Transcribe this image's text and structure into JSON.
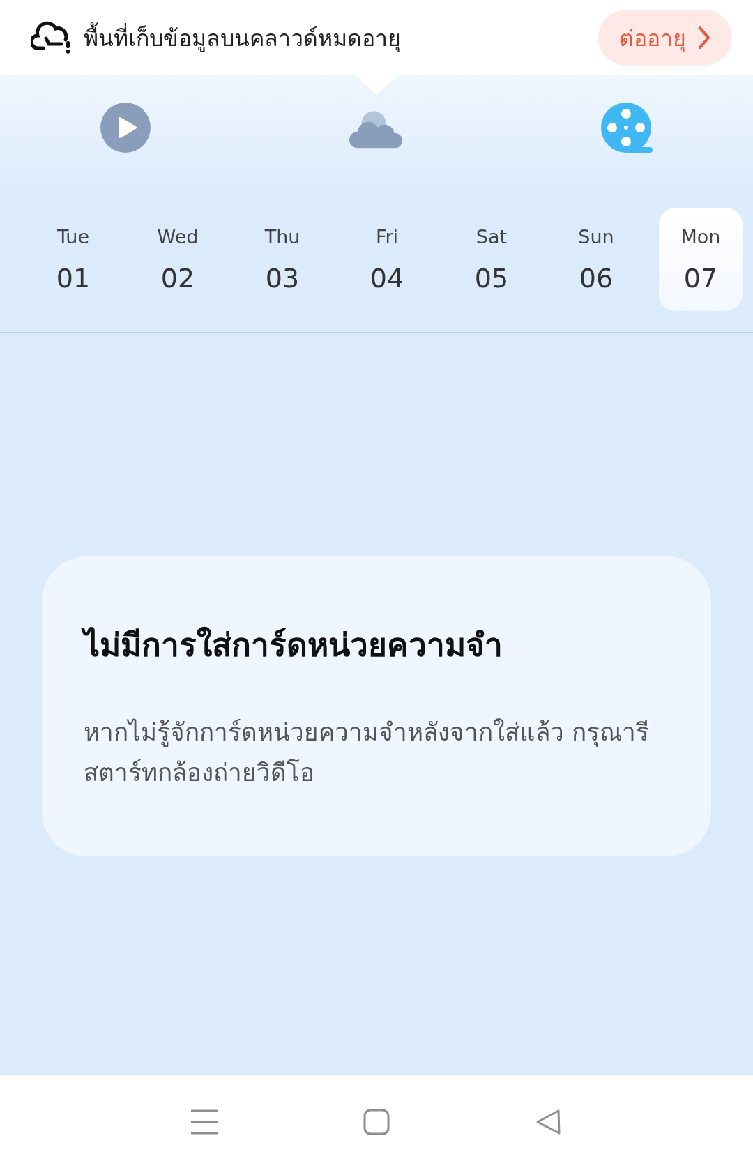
{
  "banner": {
    "message": "พื้นที่เก็บข้อมูลบนคลาวด์หมดอายุ",
    "action": "ต่ออายุ"
  },
  "tabs": [
    {
      "kind": "playback",
      "selected": false
    },
    {
      "kind": "cloud",
      "selected": true
    },
    {
      "kind": "film",
      "selected": false
    }
  ],
  "days": [
    {
      "weekday": "Tue",
      "date": "01",
      "selected": false
    },
    {
      "weekday": "Wed",
      "date": "02",
      "selected": false
    },
    {
      "weekday": "Thu",
      "date": "03",
      "selected": false
    },
    {
      "weekday": "Fri",
      "date": "04",
      "selected": false
    },
    {
      "weekday": "Sat",
      "date": "05",
      "selected": false
    },
    {
      "weekday": "Sun",
      "date": "06",
      "selected": false
    },
    {
      "weekday": "Mon",
      "date": "07",
      "selected": true
    }
  ],
  "notice": {
    "title": "ไม่มีการใส่การ์ดหน่วยความจำ",
    "message": "หากไม่รู้จักการ์ดหน่วยความจำหลังจากใส่แล้ว กรุณารีสตาร์ทกล้องถ่ายวิดีโอ"
  }
}
